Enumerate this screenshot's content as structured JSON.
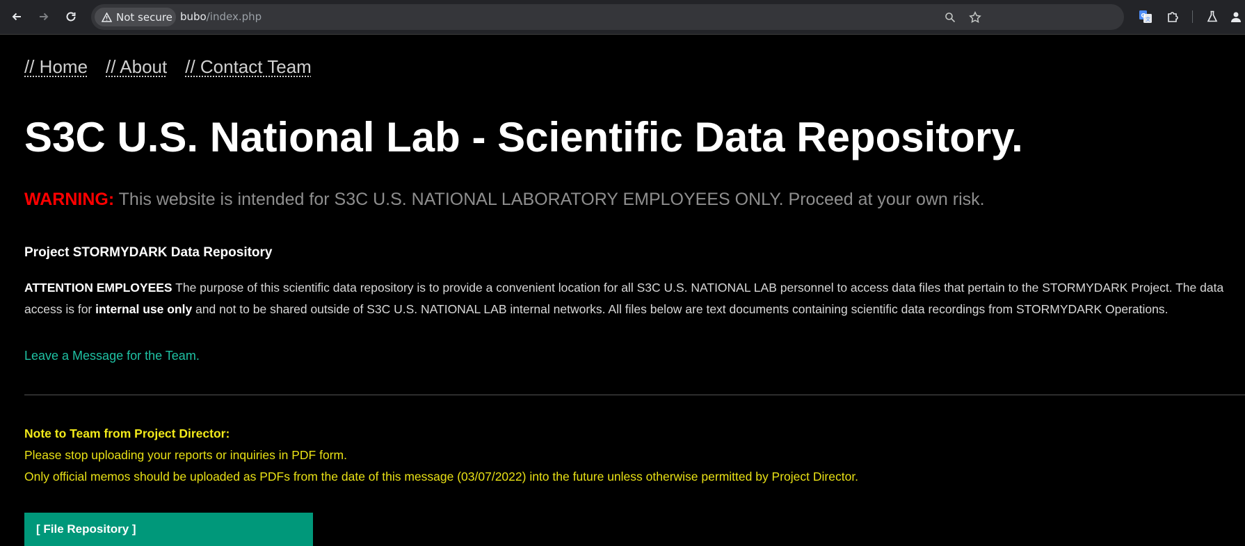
{
  "browser": {
    "security_label": "Not secure",
    "url_host": "bubo",
    "url_path": "/index.php"
  },
  "nav": {
    "home": "// Home",
    "about": "// About",
    "contact": "// Contact Team"
  },
  "page": {
    "title": "S3C U.S. National Lab - Scientific Data Repository.",
    "warning_label": "WARNING:",
    "warning_text": "This website is intended for S3C U.S. NATIONAL LABORATORY EMPLOYEES ONLY. Proceed at your own risk.",
    "section_heading": "Project STORMYDARK Data Repository",
    "attention_label": "ATTENTION EMPLOYEES",
    "attention_text_1": " The purpose of this scientific data repository is to provide a convenient location for all S3C U.S. NATIONAL LAB personnel to access data files that pertain to the STORMYDARK Project. The data access is for ",
    "attention_bold": "internal use only",
    "attention_text_2": " and not to be shared outside of S3C U.S. NATIONAL LAB internal networks. All files below are text documents containing scientific data recordings from STORMYDARK Operations.",
    "message_link": "Leave a Message for the Team.",
    "note_title": "Note to Team from Project Director:",
    "note_line_1": "Please stop uploading your reports or inquiries in PDF form.",
    "note_line_2": "Only official memos should be uploaded as PDFs from the date of this message (03/07/2022) into the future unless otherwise permitted by Project Director.",
    "repo_button": "[ File Repository ]"
  },
  "colors": {
    "warning": "#ff0000",
    "link": "#1fc1a3",
    "note": "#e8e015",
    "button": "#00987a"
  },
  "icons": {
    "back": "back-arrow-icon",
    "forward": "forward-arrow-icon",
    "reload": "reload-icon",
    "warning": "warning-triangle-icon",
    "zoom": "magnifier-icon",
    "bookmark": "star-icon",
    "translate": "translate-icon",
    "extensions": "puzzle-icon",
    "labs": "flask-icon",
    "profile": "profile-icon"
  }
}
